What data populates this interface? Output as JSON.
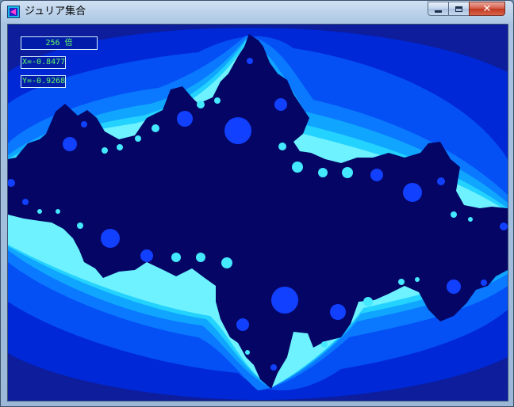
{
  "window": {
    "title": "ジュリア集合",
    "buttons": [
      "minimize",
      "maximize",
      "close"
    ]
  },
  "overlay": {
    "zoom_label": "256 倍",
    "x_label": "X=-0.8477",
    "y_label": "Y=-0.9268"
  },
  "colors": {
    "background_outer": "#0d1d9b",
    "band_1": "#0028d6",
    "band_2": "#0550f5",
    "band_3": "#0a78ff",
    "band_4": "#10a6ff",
    "band_5": "#24d2ff",
    "band_6": "#6ef2ff",
    "fractal_interior": "#050565",
    "bulb_blue": "#1240ff",
    "bulb_cyan": "#44e8ff",
    "label_text": "#66ff66"
  },
  "icons": {
    "app": "app-icon",
    "min": "minimize-icon",
    "max": "maximize-icon",
    "close": "close-icon"
  }
}
